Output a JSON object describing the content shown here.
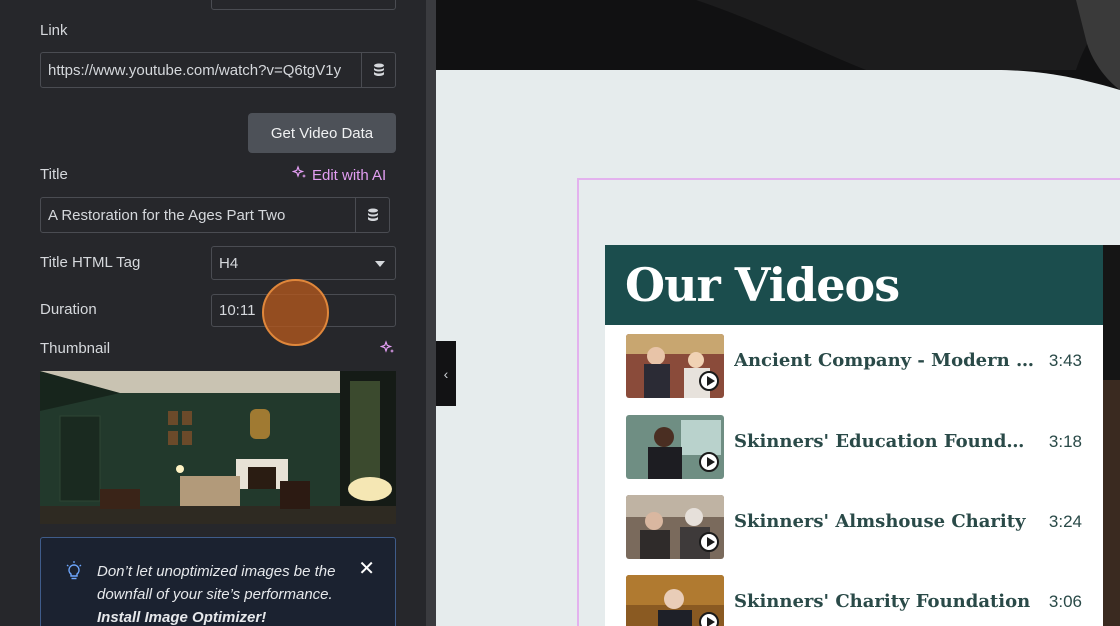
{
  "editor": {
    "link": {
      "label": "Link",
      "value": "https://www.youtube.com/watch?v=Q6tgV1y",
      "icon": "database-icon"
    },
    "get_video_data_label": "Get Video Data",
    "title": {
      "label": "Title",
      "ai_label": "Edit with AI",
      "value": "A Restoration for the Ages Part Two"
    },
    "title_tag": {
      "label": "Title HTML Tag",
      "value": "H4"
    },
    "duration": {
      "label": "Duration",
      "value": "10:11"
    },
    "thumbnail": {
      "label": "Thumbnail"
    },
    "notice": {
      "line1": "Don’t let unoptimized images be the downfall of your site’s performance.",
      "link": "Install Image Optimizer!"
    }
  },
  "preview": {
    "heading": "Our Videos",
    "videos": [
      {
        "title": "Ancient Company - Modern Mi...",
        "duration": "3:43"
      },
      {
        "title": "Skinners' Education Foundation",
        "duration": "3:18"
      },
      {
        "title": "Skinners' Almshouse Charity",
        "duration": "3:24"
      },
      {
        "title": "Skinners' Charity Foundation",
        "duration": "3:06"
      }
    ]
  },
  "colors": {
    "panel_bg": "#26272b",
    "accent_ai": "#e39ef3",
    "header_teal": "#1b4d4d",
    "title_text": "#2a4a48"
  }
}
